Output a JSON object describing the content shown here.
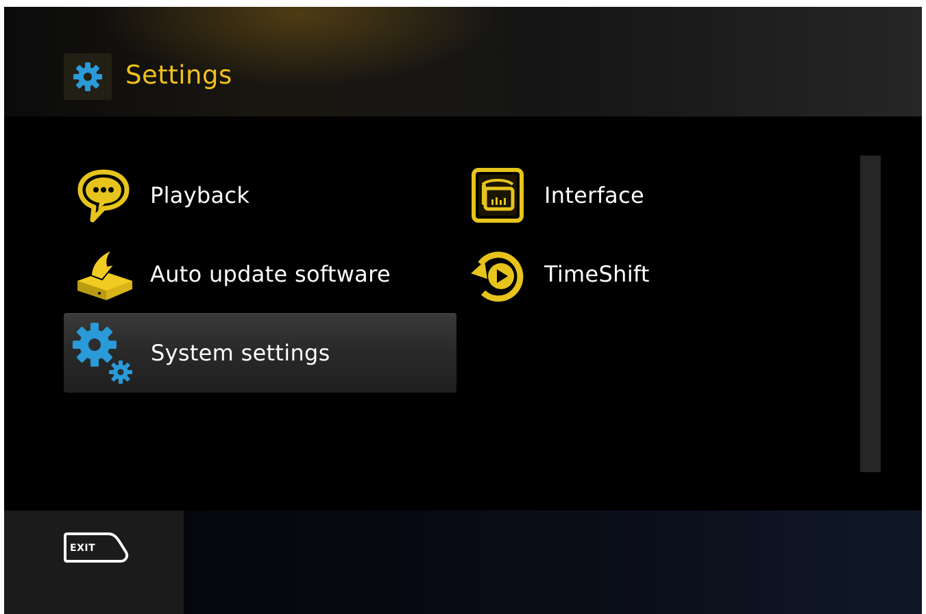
{
  "header": {
    "title": "Settings",
    "icon": "gear-icon"
  },
  "menu": {
    "items": [
      {
        "label": "Playback",
        "icon": "speech-bubble-icon"
      },
      {
        "label": "Interface",
        "icon": "interface-screen-icon"
      },
      {
        "label": "Auto update software",
        "icon": "set-top-box-update-icon"
      },
      {
        "label": "TimeShift",
        "icon": "timeshift-icon"
      },
      {
        "label": "System settings",
        "icon": "gears-icon",
        "selected": true
      }
    ]
  },
  "footer": {
    "exit_label": "EXIT"
  },
  "colors": {
    "accent": "#f2c21a",
    "icon_yellow": "#e6c41c",
    "icon_blue": "#2a9ad8",
    "text": "#ffffff",
    "background": "#000000"
  }
}
